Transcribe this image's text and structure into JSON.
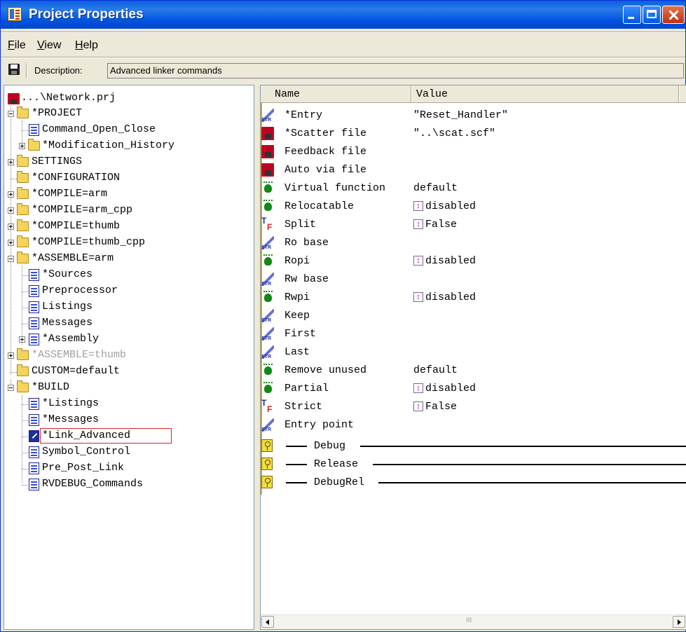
{
  "window": {
    "title": "Project Properties"
  },
  "menu": [
    {
      "label": "File"
    },
    {
      "label": "View"
    },
    {
      "label": "Help"
    }
  ],
  "toolbar": {
    "description_label": "Description:",
    "description_value": "Advanced linker commands"
  },
  "tree": [
    {
      "label": "...\\Network.prj"
    },
    {
      "label": "*PROJECT"
    },
    {
      "label": "Command_Open_Close"
    },
    {
      "label": "*Modification_History"
    },
    {
      "label": "SETTINGS"
    },
    {
      "label": "*CONFIGURATION"
    },
    {
      "label": "*COMPILE=arm"
    },
    {
      "label": "*COMPILE=arm_cpp"
    },
    {
      "label": "*COMPILE=thumb"
    },
    {
      "label": "*COMPILE=thumb_cpp"
    },
    {
      "label": "*ASSEMBLE=arm"
    },
    {
      "label": "*Sources"
    },
    {
      "label": "Preprocessor"
    },
    {
      "label": "Listings"
    },
    {
      "label": "Messages"
    },
    {
      "label": "*Assembly"
    },
    {
      "label": "*ASSEMBLE=thumb"
    },
    {
      "label": "CUSTOM=default"
    },
    {
      "label": "*BUILD"
    },
    {
      "label": "*Listings"
    },
    {
      "label": "*Messages"
    },
    {
      "label": "*Link_Advanced"
    },
    {
      "label": "Symbol_Control"
    },
    {
      "label": "Pre_Post_Link"
    },
    {
      "label": "RVDEBUG_Commands"
    }
  ],
  "list": {
    "columns": [
      "Name",
      "Value"
    ],
    "rows": [
      {
        "name": "*Entry",
        "value": "\"Reset_Handler\"",
        "icon": "string-icon"
      },
      {
        "name": "*Scatter file",
        "value": "\"..\\scat.scf\"",
        "icon": "file-icon"
      },
      {
        "name": "Feedback file",
        "value": "",
        "icon": "file-icon"
      },
      {
        "name": "Auto via file",
        "value": "",
        "icon": "file-icon"
      },
      {
        "name": "Virtual function",
        "value": "default",
        "icon": "option-icon"
      },
      {
        "name": "Relocatable",
        "value": "disabled",
        "icon": "option-icon",
        "check": "↕"
      },
      {
        "name": "Split",
        "value": "False",
        "icon": "boolean-icon",
        "check": "↕"
      },
      {
        "name": "Ro base",
        "value": "",
        "icon": "string-icon"
      },
      {
        "name": "Ropi",
        "value": "disabled",
        "icon": "option-icon",
        "check": "↕"
      },
      {
        "name": "Rw base",
        "value": "",
        "icon": "string-icon"
      },
      {
        "name": "Rwpi",
        "value": "disabled",
        "icon": "option-icon",
        "check": "↕"
      },
      {
        "name": "Keep",
        "value": "",
        "icon": "string-icon"
      },
      {
        "name": "First",
        "value": "",
        "icon": "string-icon"
      },
      {
        "name": "Last",
        "value": "",
        "icon": "string-icon"
      },
      {
        "name": "Remove unused",
        "value": "default",
        "icon": "option-icon"
      },
      {
        "name": "Partial",
        "value": "disabled",
        "icon": "option-icon",
        "check": "↕"
      },
      {
        "name": "Strict",
        "value": "False",
        "icon": "boolean-icon",
        "check": "↕"
      },
      {
        "name": "Entry point",
        "value": "",
        "icon": "string-icon"
      }
    ],
    "groups": [
      {
        "label": "Debug"
      },
      {
        "label": "Release"
      },
      {
        "label": "DebugRel"
      }
    ]
  },
  "scrollbar": {
    "grip": "III"
  }
}
